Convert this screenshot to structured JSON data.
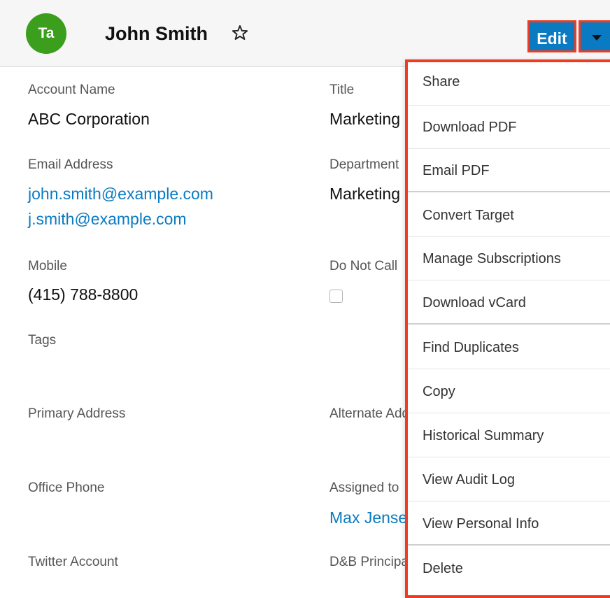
{
  "header": {
    "avatar_initials": "Ta",
    "avatar_color": "#3b9e1c",
    "record_name": "John Smith",
    "favorite_icon": "star-outline-icon",
    "edit_label": "Edit",
    "actions_icon": "caret-down-icon",
    "accent": "#0a7bc2",
    "highlight": "#ef3b1f"
  },
  "fields": {
    "account_name": {
      "label": "Account Name",
      "value": "ABC Corporation"
    },
    "title": {
      "label": "Title",
      "value": "Marketing Director"
    },
    "email": {
      "label": "Email Address",
      "values": [
        "john.smith@example.com",
        "j.smith@example.com"
      ]
    },
    "department": {
      "label": "Department",
      "value": "Marketing"
    },
    "mobile": {
      "label": "Mobile",
      "value": "(415) 788-8800"
    },
    "do_not_call": {
      "label": "Do Not Call",
      "checked": false
    },
    "tags": {
      "label": "Tags"
    },
    "primary_address": {
      "label": "Primary Address"
    },
    "alternate_address": {
      "label": "Alternate Address"
    },
    "office_phone": {
      "label": "Office Phone"
    },
    "assigned_to": {
      "label": "Assigned to",
      "value": "Max Jensen"
    },
    "twitter": {
      "label": "Twitter Account"
    },
    "dnb": {
      "label": "D&B Principal Id"
    }
  },
  "dropdown": {
    "items": [
      {
        "label": "Share"
      },
      {
        "label": "Download PDF"
      },
      {
        "label": "Email PDF"
      },
      {
        "label": "Convert Target"
      },
      {
        "label": "Manage Subscriptions"
      },
      {
        "label": "Download vCard"
      },
      {
        "label": "Find Duplicates"
      },
      {
        "label": "Copy"
      },
      {
        "label": "Historical Summary"
      },
      {
        "label": "View Audit Log"
      },
      {
        "label": "View Personal Info"
      },
      {
        "label": "Delete"
      }
    ]
  }
}
